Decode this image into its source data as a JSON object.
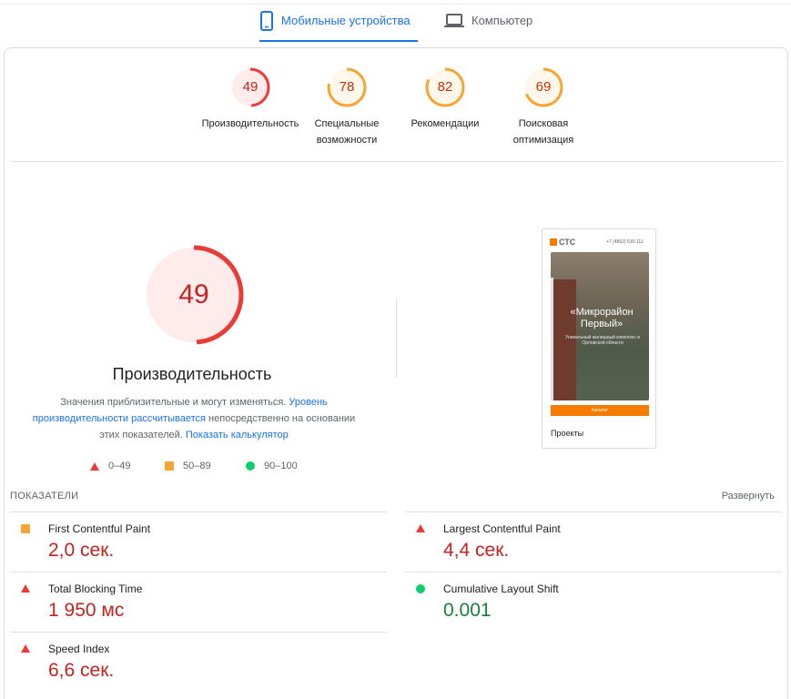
{
  "tabs": {
    "mobile": "Мобильные устройства",
    "desktop": "Компьютер"
  },
  "categories": [
    {
      "score": 49,
      "label": "Производительность",
      "color": "#eb3b36"
    },
    {
      "score": 78,
      "label": "Специальные возможности",
      "color": "#f6a534"
    },
    {
      "score": 82,
      "label": "Рекомендации",
      "color": "#f6a534"
    },
    {
      "score": 69,
      "label": "Поисковая оптимизация",
      "color": "#f6a534"
    }
  ],
  "performance": {
    "score": 49,
    "title": "Производительность",
    "desc_1": "Значения приблизительные и могут изменяться.",
    "link_1": "Уровень производительности рассчитывается",
    "desc_2": "непосредственно на основании этих показателей.",
    "link_2": "Показать калькулятор"
  },
  "legend": {
    "bad": "0–49",
    "average": "50–89",
    "good": "90–100"
  },
  "screenshot": {
    "logo": "СТС",
    "phone": "+7 (4862) 630-111",
    "headline": "«Микрорайон Первый»",
    "sub": "Уникальный жилищный комплекс в Орловской области",
    "cta": "Каталог",
    "section": "Проекты"
  },
  "metrics": {
    "heading": "ПОКАЗАТЕЛИ",
    "expand": "Развернуть",
    "fcp": {
      "name": "First Contentful Paint",
      "value": "2,0 сек."
    },
    "lcp": {
      "name": "Largest Contentful Paint",
      "value": "4,4 сек."
    },
    "tbt": {
      "name": "Total Blocking Time",
      "value": "1 950 мс"
    },
    "cls": {
      "name": "Cumulative Layout Shift",
      "value": "0.001"
    },
    "si": {
      "name": "Speed Index",
      "value": "6,6 сек."
    }
  },
  "colors": {
    "accent": "#1a73e8",
    "fail": "#eb3b36",
    "average": "#f6a534",
    "pass": "#0cce6b"
  }
}
